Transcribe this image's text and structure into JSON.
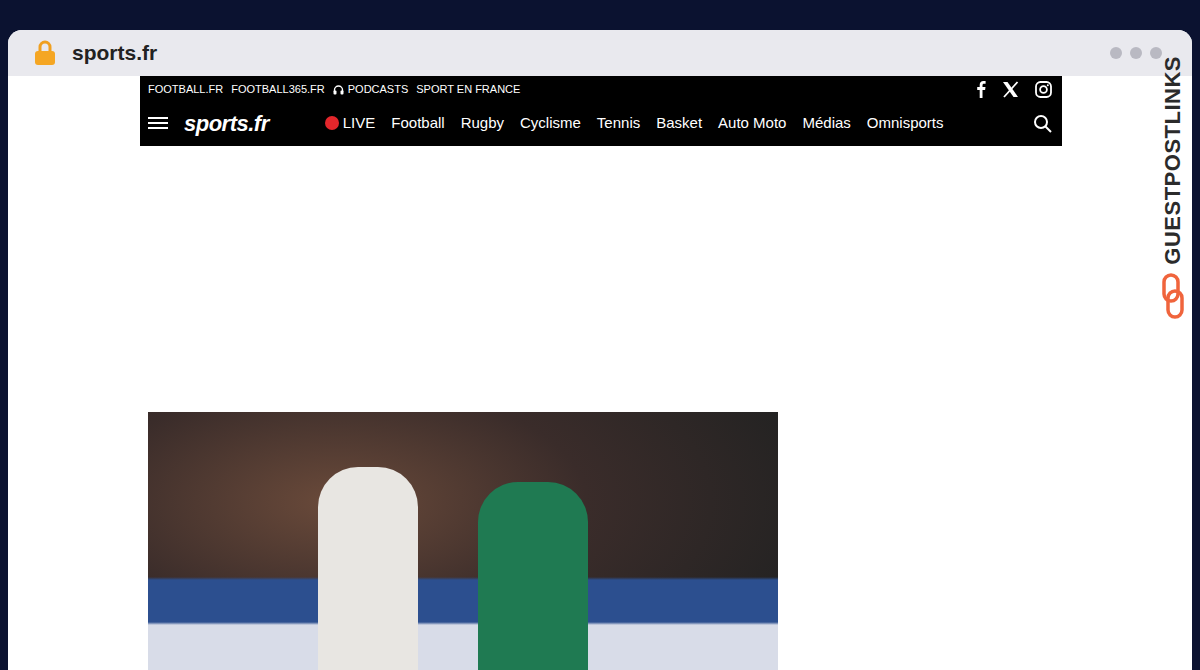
{
  "browser": {
    "address": "sports.fr"
  },
  "watermark": "GUESTPOSTLINKS",
  "site": {
    "top_links": [
      "FOOTBALL.FR",
      "FOOTBALL365.FR",
      "PODCASTS",
      "SPORT EN FRANCE"
    ],
    "logo": "sports.fr",
    "live": "LIVE",
    "nav": [
      "Football",
      "Rugby",
      "Cyclisme",
      "Tennis",
      "Basket",
      "Auto Moto",
      "Médias",
      "Omnisports"
    ]
  }
}
